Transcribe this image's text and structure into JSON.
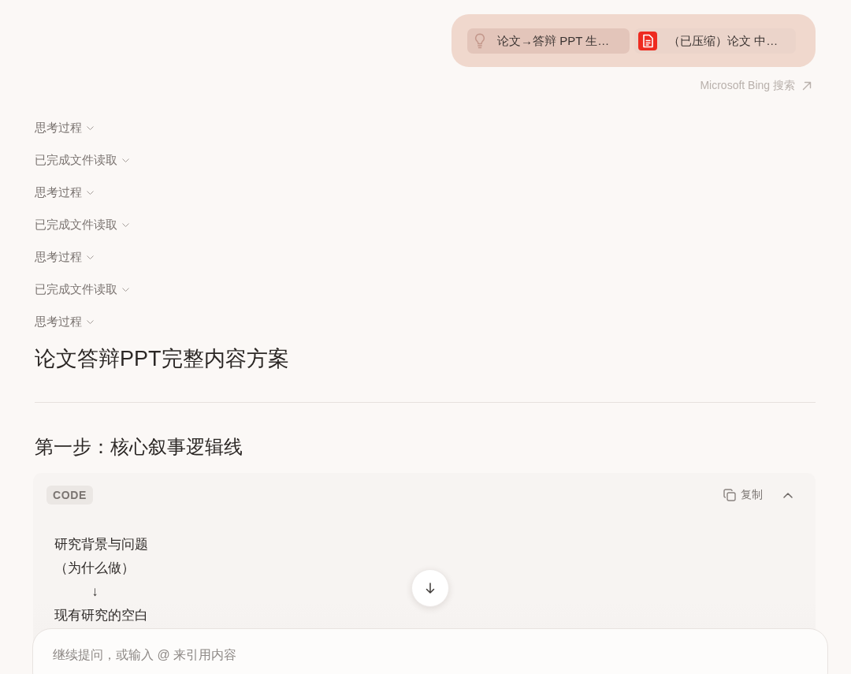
{
  "user_message": {
    "attachments": [
      {
        "kind": "prompt",
        "label": "论文→答辩 PPT 生…"
      },
      {
        "kind": "file",
        "label": "（已压缩）论文 中…"
      }
    ]
  },
  "search_link": {
    "label": "Microsoft Bing 搜索"
  },
  "steps": [
    {
      "label": "思考过程",
      "expanded": false
    },
    {
      "label": "已完成文件读取",
      "expanded": false
    },
    {
      "label": "思考过程",
      "expanded": false
    },
    {
      "label": "已完成文件读取",
      "expanded": false
    },
    {
      "label": "思考过程",
      "expanded": false
    },
    {
      "label": "已完成文件读取",
      "expanded": false
    },
    {
      "label": "思考过程",
      "expanded": false
    }
  ],
  "answer": {
    "title": "论文答辩PPT完整内容方案",
    "section_heading": "第一步：核心叙事逻辑线",
    "code_block": {
      "language": "CODE",
      "copy_label": "复制",
      "expanded": true,
      "lines": [
        "研究背景与问题",
        "（为什么做）",
        "          ↓",
        "现有研究的空白"
      ]
    }
  },
  "composer": {
    "placeholder": "继续提问，或输入 @ 来引用内容"
  }
}
